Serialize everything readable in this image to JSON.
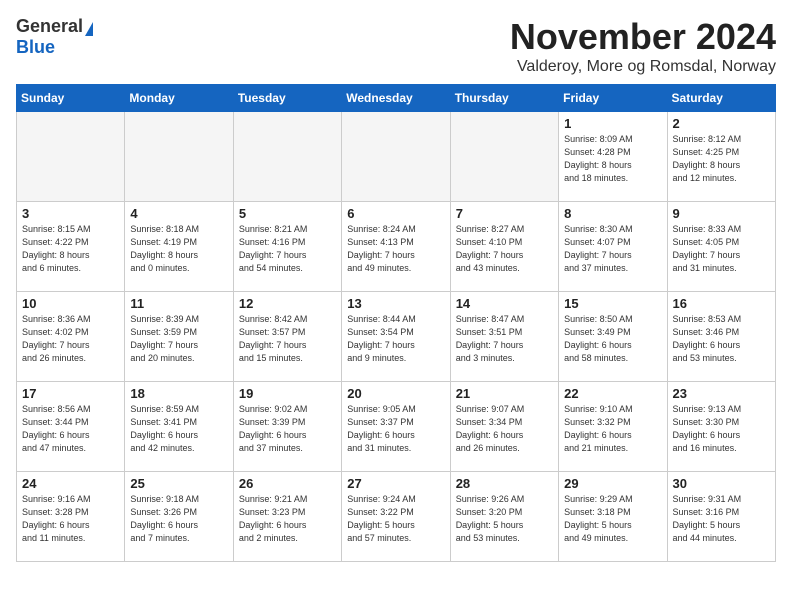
{
  "logo": {
    "general": "General",
    "blue": "Blue"
  },
  "header": {
    "month": "November 2024",
    "location": "Valderoy, More og Romsdal, Norway"
  },
  "weekdays": [
    "Sunday",
    "Monday",
    "Tuesday",
    "Wednesday",
    "Thursday",
    "Friday",
    "Saturday"
  ],
  "weeks": [
    [
      {
        "day": "",
        "info": ""
      },
      {
        "day": "",
        "info": ""
      },
      {
        "day": "",
        "info": ""
      },
      {
        "day": "",
        "info": ""
      },
      {
        "day": "",
        "info": ""
      },
      {
        "day": "1",
        "info": "Sunrise: 8:09 AM\nSunset: 4:28 PM\nDaylight: 8 hours\nand 18 minutes."
      },
      {
        "day": "2",
        "info": "Sunrise: 8:12 AM\nSunset: 4:25 PM\nDaylight: 8 hours\nand 12 minutes."
      }
    ],
    [
      {
        "day": "3",
        "info": "Sunrise: 8:15 AM\nSunset: 4:22 PM\nDaylight: 8 hours\nand 6 minutes."
      },
      {
        "day": "4",
        "info": "Sunrise: 8:18 AM\nSunset: 4:19 PM\nDaylight: 8 hours\nand 0 minutes."
      },
      {
        "day": "5",
        "info": "Sunrise: 8:21 AM\nSunset: 4:16 PM\nDaylight: 7 hours\nand 54 minutes."
      },
      {
        "day": "6",
        "info": "Sunrise: 8:24 AM\nSunset: 4:13 PM\nDaylight: 7 hours\nand 49 minutes."
      },
      {
        "day": "7",
        "info": "Sunrise: 8:27 AM\nSunset: 4:10 PM\nDaylight: 7 hours\nand 43 minutes."
      },
      {
        "day": "8",
        "info": "Sunrise: 8:30 AM\nSunset: 4:07 PM\nDaylight: 7 hours\nand 37 minutes."
      },
      {
        "day": "9",
        "info": "Sunrise: 8:33 AM\nSunset: 4:05 PM\nDaylight: 7 hours\nand 31 minutes."
      }
    ],
    [
      {
        "day": "10",
        "info": "Sunrise: 8:36 AM\nSunset: 4:02 PM\nDaylight: 7 hours\nand 26 minutes."
      },
      {
        "day": "11",
        "info": "Sunrise: 8:39 AM\nSunset: 3:59 PM\nDaylight: 7 hours\nand 20 minutes."
      },
      {
        "day": "12",
        "info": "Sunrise: 8:42 AM\nSunset: 3:57 PM\nDaylight: 7 hours\nand 15 minutes."
      },
      {
        "day": "13",
        "info": "Sunrise: 8:44 AM\nSunset: 3:54 PM\nDaylight: 7 hours\nand 9 minutes."
      },
      {
        "day": "14",
        "info": "Sunrise: 8:47 AM\nSunset: 3:51 PM\nDaylight: 7 hours\nand 3 minutes."
      },
      {
        "day": "15",
        "info": "Sunrise: 8:50 AM\nSunset: 3:49 PM\nDaylight: 6 hours\nand 58 minutes."
      },
      {
        "day": "16",
        "info": "Sunrise: 8:53 AM\nSunset: 3:46 PM\nDaylight: 6 hours\nand 53 minutes."
      }
    ],
    [
      {
        "day": "17",
        "info": "Sunrise: 8:56 AM\nSunset: 3:44 PM\nDaylight: 6 hours\nand 47 minutes."
      },
      {
        "day": "18",
        "info": "Sunrise: 8:59 AM\nSunset: 3:41 PM\nDaylight: 6 hours\nand 42 minutes."
      },
      {
        "day": "19",
        "info": "Sunrise: 9:02 AM\nSunset: 3:39 PM\nDaylight: 6 hours\nand 37 minutes."
      },
      {
        "day": "20",
        "info": "Sunrise: 9:05 AM\nSunset: 3:37 PM\nDaylight: 6 hours\nand 31 minutes."
      },
      {
        "day": "21",
        "info": "Sunrise: 9:07 AM\nSunset: 3:34 PM\nDaylight: 6 hours\nand 26 minutes."
      },
      {
        "day": "22",
        "info": "Sunrise: 9:10 AM\nSunset: 3:32 PM\nDaylight: 6 hours\nand 21 minutes."
      },
      {
        "day": "23",
        "info": "Sunrise: 9:13 AM\nSunset: 3:30 PM\nDaylight: 6 hours\nand 16 minutes."
      }
    ],
    [
      {
        "day": "24",
        "info": "Sunrise: 9:16 AM\nSunset: 3:28 PM\nDaylight: 6 hours\nand 11 minutes."
      },
      {
        "day": "25",
        "info": "Sunrise: 9:18 AM\nSunset: 3:26 PM\nDaylight: 6 hours\nand 7 minutes."
      },
      {
        "day": "26",
        "info": "Sunrise: 9:21 AM\nSunset: 3:23 PM\nDaylight: 6 hours\nand 2 minutes."
      },
      {
        "day": "27",
        "info": "Sunrise: 9:24 AM\nSunset: 3:22 PM\nDaylight: 5 hours\nand 57 minutes."
      },
      {
        "day": "28",
        "info": "Sunrise: 9:26 AM\nSunset: 3:20 PM\nDaylight: 5 hours\nand 53 minutes."
      },
      {
        "day": "29",
        "info": "Sunrise: 9:29 AM\nSunset: 3:18 PM\nDaylight: 5 hours\nand 49 minutes."
      },
      {
        "day": "30",
        "info": "Sunrise: 9:31 AM\nSunset: 3:16 PM\nDaylight: 5 hours\nand 44 minutes."
      }
    ]
  ]
}
